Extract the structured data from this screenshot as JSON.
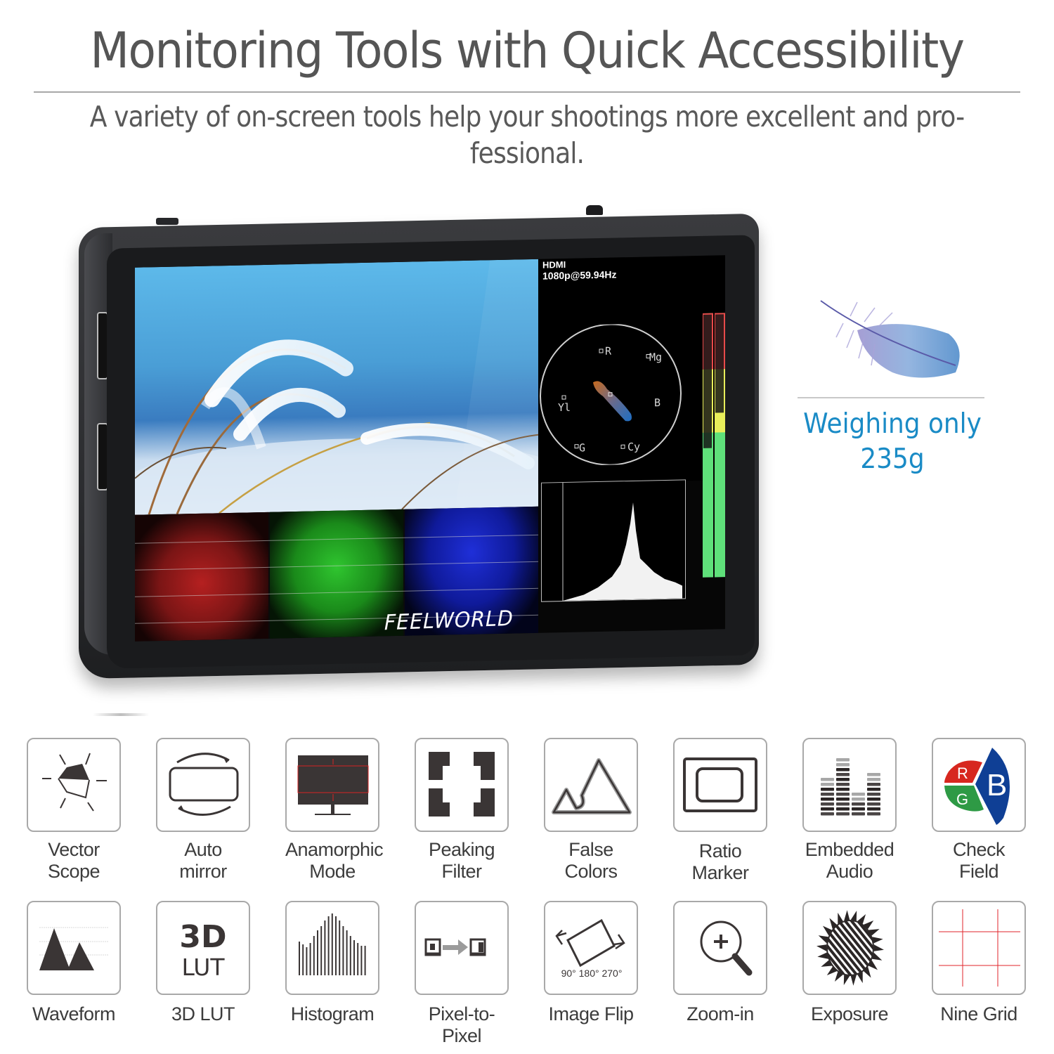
{
  "header": {
    "title": "Monitoring Tools with Quick Accessibility",
    "subtitle_line1": "A variety of on-screen tools help your shootings more excellent and pro-",
    "subtitle_line2": "fessional."
  },
  "monitor": {
    "brand": "FEELWORLD",
    "screen": {
      "signal_source": "HDMI",
      "signal_format": "1080p@59.94Hz",
      "vectorscope_labels": [
        "R",
        "Mg",
        "Yl",
        "B",
        "G",
        "Cy"
      ]
    }
  },
  "weight_callout": {
    "line1": "Weighing only",
    "line2": "235g",
    "color": "#1a8bc6"
  },
  "features": [
    {
      "label_line1": "Vector",
      "label_line2": "Scope",
      "icon": "vectorscope-icon"
    },
    {
      "label_line1": "Auto",
      "label_line2": "mirror",
      "icon": "auto-mirror-icon"
    },
    {
      "label_line1": "Anamorphic",
      "label_line2": "Mode",
      "icon": "anamorphic-monitor-icon"
    },
    {
      "label_line1": "Peaking",
      "label_line2": "Filter",
      "icon": "peaking-corners-icon"
    },
    {
      "label_line1": "False",
      "label_line2": "Colors",
      "icon": "mountain-icon"
    },
    {
      "label_line1": "Ratio",
      "label_line2": "Marker",
      "icon": "ratio-frame-icon"
    },
    {
      "label_line1": "Embedded",
      "label_line2": "Audio",
      "icon": "audio-levels-icon"
    },
    {
      "label_line1": "Check",
      "label_line2": "Field",
      "icon": "rgb-check-icon"
    },
    {
      "label": "Waveform",
      "icon": "waveform-peaks-icon"
    },
    {
      "label": "3D LUT",
      "icon": "3d-lut-icon",
      "icon_text_top": "3D",
      "icon_text_bottom": "LUT"
    },
    {
      "label": "Histogram",
      "icon": "histogram-bars-icon"
    },
    {
      "label": "Pixel-to-Pixel",
      "icon": "pixel-to-pixel-icon"
    },
    {
      "label": "Image Flip",
      "icon": "image-flip-icon",
      "icon_text": "90° 180° 270°"
    },
    {
      "label": "Zoom-in",
      "icon": "magnifier-plus-icon"
    },
    {
      "label": "Exposure",
      "icon": "sun-exposure-icon"
    },
    {
      "label": "Nine Grid",
      "icon": "nine-grid-icon"
    }
  ],
  "check_field_letters": {
    "r": "R",
    "g": "G",
    "b": "B"
  },
  "colors": {
    "title_gray": "#555555",
    "accent_blue": "#1a8bc6",
    "icon_dark": "#3a3535",
    "rgb_red": "#d7271f",
    "rgb_green": "#2e9a45",
    "rgb_blue": "#0f3f95",
    "grid_red": "#e0262b"
  }
}
